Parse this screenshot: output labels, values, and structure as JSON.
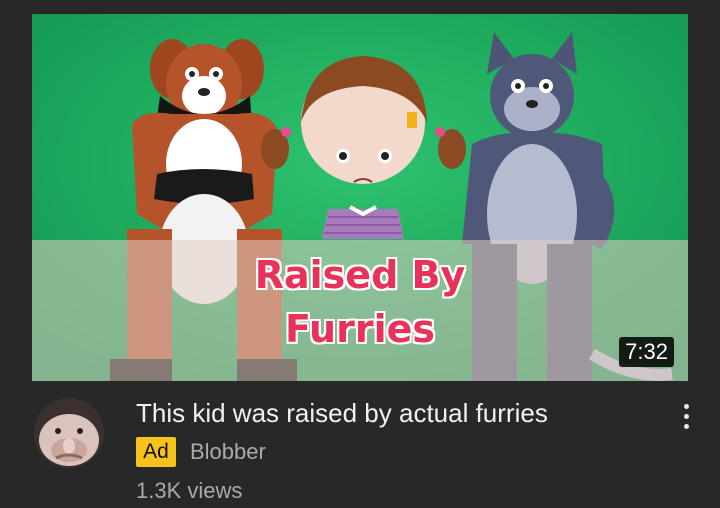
{
  "thumbnail": {
    "caption_line1": "Raised By",
    "caption_line2": "Furries",
    "duration": "7:32"
  },
  "video": {
    "title": "This kid was raised by actual furries",
    "ad_label": "Ad",
    "channel": "Blobber",
    "views": "1.3K views"
  },
  "colors": {
    "background": "#282828",
    "ad_badge": "#f7c21c",
    "caption": "#e8325a",
    "thumbnail_bg": "#1faa62"
  },
  "icons": {
    "menu": "more-vert-icon"
  }
}
